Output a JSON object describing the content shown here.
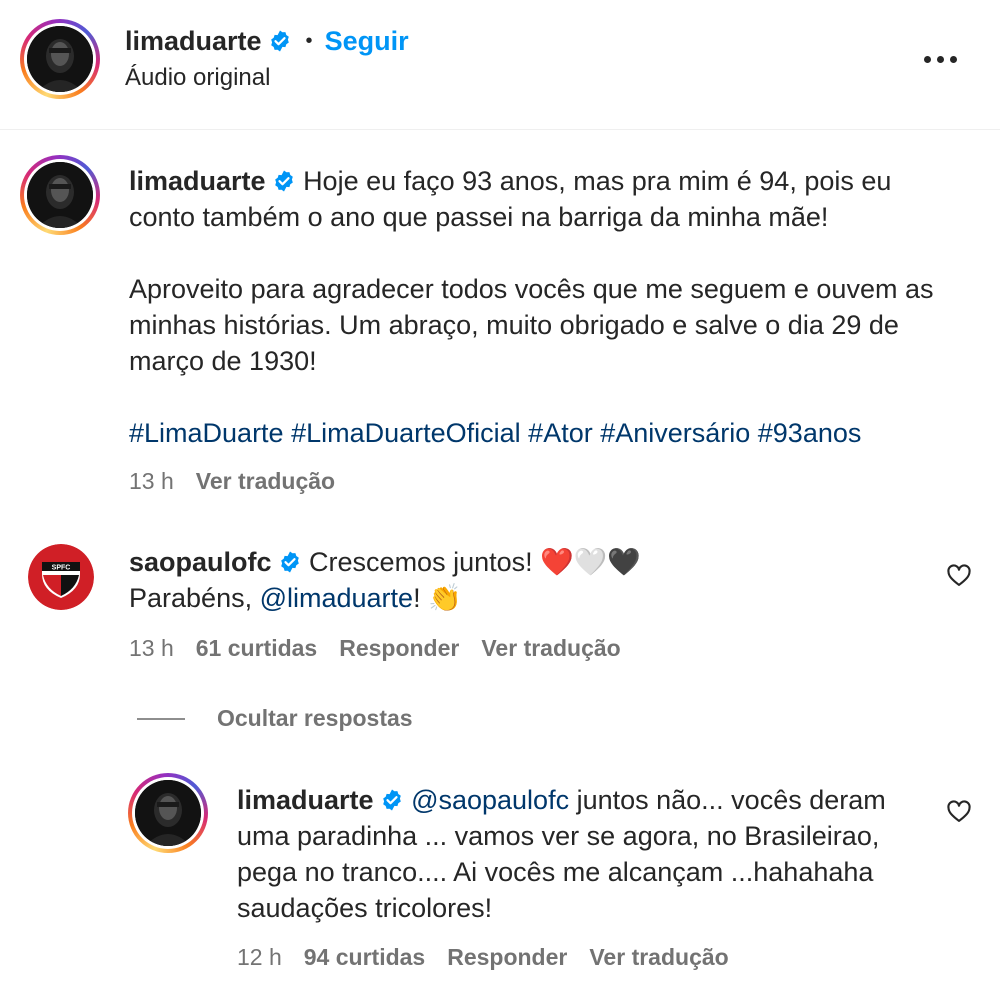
{
  "header": {
    "username": "limaduarte",
    "separator": "•",
    "follow_label": "Seguir",
    "subtitle": "Áudio original",
    "more_icon": "more-horizontal-icon"
  },
  "caption": {
    "username": "limaduarte",
    "text_1": "Hoje eu faço 93 anos, mas pra mim é 94, pois eu conto também o ano que passei na barriga da minha mãe!",
    "text_2": "Aproveito para agradecer todos vocês que me seguem e ouvem as minhas histórias. Um abraço, muito obrigado e salve o dia 29 de março de 1930!",
    "hashtags": "#LimaDuarte #LimaDuarteOficial #Ator #Aniversário #93anos",
    "time": "13 h",
    "translate_label": "Ver tradução"
  },
  "comment": {
    "username": "saopaulofc",
    "avatar_text": "SPFC",
    "text": "Crescemos juntos! ❤️🤍🖤",
    "text_line2_prefix": "Parabéns, ",
    "mention": "@limaduarte",
    "text_line2_suffix": "! 👏",
    "time": "13 h",
    "likes": "61 curtidas",
    "reply_label": "Responder",
    "translate_label": "Ver tradução"
  },
  "replies_toggle": "Ocultar respostas",
  "reply": {
    "username": "limaduarte",
    "mention": "@saopaulofc",
    "text": " juntos não... vocês deram uma paradinha ... vamos ver se agora, no Brasileirao, pega no tranco.... Ai vocês me alcançam ...hahahaha saudações tricolores!",
    "time": "12 h",
    "likes": "94 curtidas",
    "reply_label": "Responder",
    "translate_label": "Ver tradução"
  },
  "colors": {
    "follow": "#0095f6",
    "link": "#00376b",
    "verified": "#0095f6",
    "meta_text": "#737373"
  }
}
